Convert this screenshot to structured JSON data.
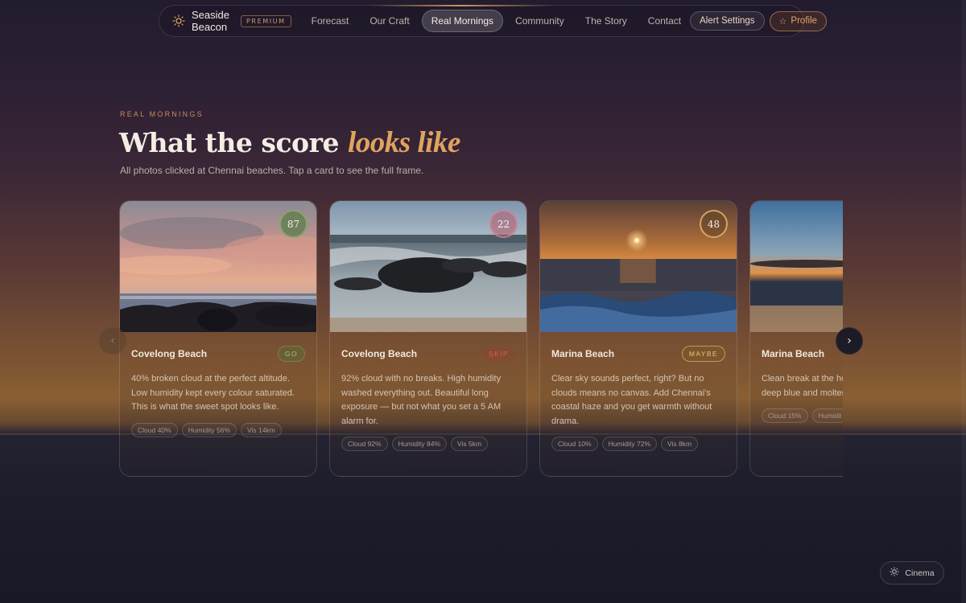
{
  "nav": {
    "brand": "Seaside Beacon",
    "premium_badge": "PREMIUM",
    "links": [
      "Forecast",
      "Our Craft",
      "Real Mornings",
      "Community",
      "The Story",
      "Contact"
    ],
    "active_link": "Real Mornings",
    "alert_button": "Alert Settings",
    "profile_button": "Profile"
  },
  "section": {
    "eyebrow": "REAL MORNINGS",
    "title_plain": "What the score",
    "title_accent": "looks like",
    "subtitle": "All photos clicked at Chennai beaches. Tap a card to see the full frame."
  },
  "cards": [
    {
      "score": "87",
      "location": "Covelong Beach",
      "verdict": "GO",
      "description": "40% broken cloud at the perfect altitude. Low humidity kept every colour saturated. This is what the sweet spot looks like.",
      "chips": [
        "Cloud 40%",
        "Humidity 56%",
        "Vis 14km"
      ]
    },
    {
      "score": "22",
      "location": "Covelong Beach",
      "verdict": "SKIP",
      "description": "92% cloud with no breaks. High humidity washed everything out. Beautiful long exposure — but not what you set a 5 AM alarm for.",
      "chips": [
        "Cloud 92%",
        "Humidity 84%",
        "Vis 5km"
      ]
    },
    {
      "score": "48",
      "location": "Marina Beach",
      "verdict": "MAYBE",
      "description": "Clear sky sounds perfect, right? But no clouds means no canvas. Add Chennai's coastal haze and you get warmth without drama.",
      "chips": [
        "Cloud 10%",
        "Humidity 72%",
        "Vis 8km"
      ]
    },
    {
      "score": "",
      "location": "Marina Beach",
      "verdict": "",
      "description": "Clean break at the ho humidity gave razor-s deep blue and molter",
      "chips": [
        "Cloud 15%",
        "Humidit"
      ]
    }
  ],
  "cinema_button": "Cinema",
  "colors": {
    "accent": "#e0a35f",
    "go": "#9dc07d",
    "skip": "#e05a4e",
    "maybe": "#efc27a"
  },
  "icons": {
    "brand": "sun-icon",
    "profile": "star-icon",
    "prev": "chevron-left-icon",
    "next": "chevron-right-icon",
    "cinema": "sun-icon"
  }
}
